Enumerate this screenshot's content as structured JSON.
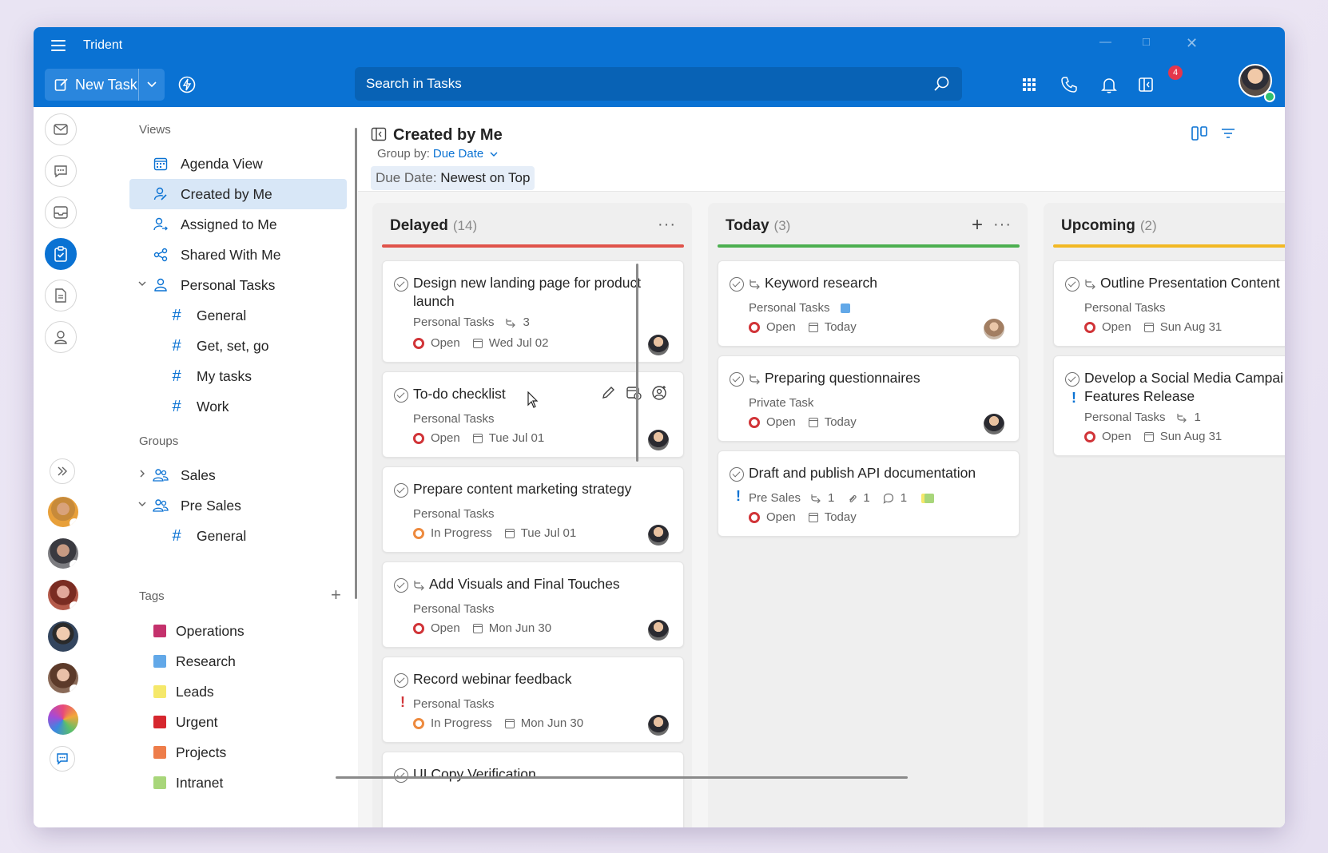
{
  "app": {
    "title": "Trident"
  },
  "toolbar": {
    "new_task": "New Task",
    "search_placeholder": "Search in Tasks",
    "notifications_count": "4"
  },
  "sidebar": {
    "views_label": "Views",
    "views": [
      {
        "label": "Agenda View",
        "icon": "calendar-icon"
      },
      {
        "label": "Created by Me",
        "icon": "person-edit-icon",
        "selected": true
      },
      {
        "label": "Assigned to Me",
        "icon": "person-arrow-icon"
      },
      {
        "label": "Shared With Me",
        "icon": "share-icon"
      },
      {
        "label": "Personal Tasks",
        "icon": "person-icon",
        "expanded": true
      }
    ],
    "personal_children": [
      "General",
      "Get, set, go",
      "My tasks",
      "Work"
    ],
    "groups_label": "Groups",
    "groups": [
      {
        "label": "Sales",
        "expanded": false
      },
      {
        "label": "Pre Sales",
        "expanded": true
      }
    ],
    "presales_children": [
      "General"
    ],
    "tags_label": "Tags",
    "tags": [
      {
        "label": "Operations",
        "color": "#c4316c"
      },
      {
        "label": "Research",
        "color": "#62a8e8"
      },
      {
        "label": "Leads",
        "color": "#f5e86a"
      },
      {
        "label": "Urgent",
        "color": "#d6272e"
      },
      {
        "label": "Projects",
        "color": "#ee7d4a"
      },
      {
        "label": "Intranet",
        "color": "#a8d67a"
      }
    ]
  },
  "main": {
    "title": "Created by Me",
    "group_by_label": "Group by:",
    "group_by_value": "Due Date",
    "sort_key": "Due Date:",
    "sort_value": "Newest on Top"
  },
  "columns": [
    {
      "name": "Delayed",
      "count": "(14)",
      "color": "#e0534a",
      "cards": [
        {
          "title": "Design new landing page for product launch",
          "project": "Personal Tasks",
          "subtasks": "3",
          "status": "Open",
          "date": "Wed Jul 02"
        },
        {
          "title": "To-do checklist",
          "project": "Personal Tasks",
          "status": "Open",
          "date": "Tue Jul 01"
        },
        {
          "title": "Prepare content marketing strategy",
          "project": "Personal Tasks",
          "status": "In Progress",
          "date": "Tue Jul 01"
        },
        {
          "title": "Add Visuals and Final Touches",
          "project": "Personal Tasks",
          "status": "Open",
          "date": "Mon Jun 30"
        },
        {
          "title": "Record webinar feedback",
          "project": "Personal Tasks",
          "status": "In Progress",
          "date": "Mon Jun 30"
        },
        {
          "title": "UI Copy Verification"
        }
      ]
    },
    {
      "name": "Today",
      "count": "(3)",
      "color": "#4caf50",
      "cards": [
        {
          "title": "Keyword research",
          "project": "Personal Tasks",
          "status": "Open",
          "date": "Today"
        },
        {
          "title": "Preparing questionnaires",
          "project": "Private Task",
          "status": "Open",
          "date": "Today"
        },
        {
          "title": "Draft and publish API documentation",
          "project": "Pre Sales",
          "subtasks": "1",
          "attachments": "1",
          "comments": "1",
          "status": "Open",
          "date": "Today"
        }
      ]
    },
    {
      "name": "Upcoming",
      "count": "(2)",
      "color": "#f2b824",
      "cards": [
        {
          "title": "Outline Presentation Content",
          "project": "Personal Tasks",
          "status": "Open",
          "date": "Sun Aug 31"
        },
        {
          "title": "Develop a Social Media Campaign Features Release",
          "title_line1": "Develop a Social Media Campai",
          "title_line2": "Features Release",
          "project": "Personal Tasks",
          "subtasks": "1",
          "status": "Open",
          "date": "Sun Aug 31"
        }
      ]
    }
  ]
}
